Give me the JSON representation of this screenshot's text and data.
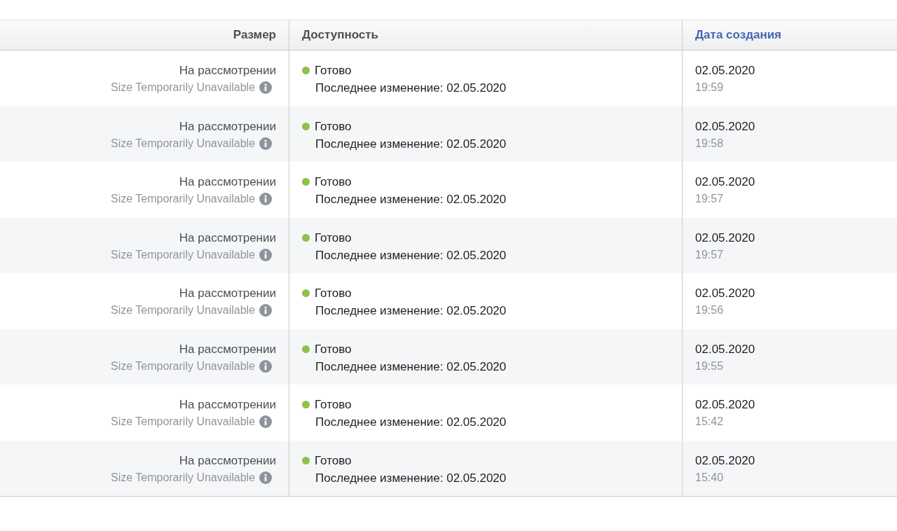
{
  "table": {
    "columns": [
      {
        "label": "Размер",
        "selected": false
      },
      {
        "label": "Доступность",
        "selected": false
      },
      {
        "label": "Дата создания",
        "selected": true
      }
    ],
    "rows": [
      {
        "size": "На рассмотрении",
        "size_note": "Size Temporarily Unavailable",
        "status": "Готово",
        "color": "#8bc34a",
        "modified": "Последнее изменение: 02.05.2020",
        "date": "02.05.2020",
        "time": "19:59"
      },
      {
        "size": "На рассмотрении",
        "size_note": "Size Temporarily Unavailable",
        "status": "Готово",
        "color": "#8bc34a",
        "modified": "Последнее изменение: 02.05.2020",
        "date": "02.05.2020",
        "time": "19:58"
      },
      {
        "size": "На рассмотрении",
        "size_note": "Size Temporarily Unavailable",
        "status": "Готово",
        "color": "#8bc34a",
        "modified": "Последнее изменение: 02.05.2020",
        "date": "02.05.2020",
        "time": "19:57"
      },
      {
        "size": "На рассмотрении",
        "size_note": "Size Temporarily Unavailable",
        "status": "Готово",
        "color": "#8bc34a",
        "modified": "Последнее изменение: 02.05.2020",
        "date": "02.05.2020",
        "time": "19:57"
      },
      {
        "size": "На рассмотрении",
        "size_note": "Size Temporarily Unavailable",
        "status": "Готово",
        "color": "#8bc34a",
        "modified": "Последнее изменение: 02.05.2020",
        "date": "02.05.2020",
        "time": "19:56"
      },
      {
        "size": "На рассмотрении",
        "size_note": "Size Temporarily Unavailable",
        "status": "Готово",
        "color": "#8bc34a",
        "modified": "Последнее изменение: 02.05.2020",
        "date": "02.05.2020",
        "time": "19:55"
      },
      {
        "size": "На рассмотрении",
        "size_note": "Size Temporarily Unavailable",
        "status": "Готово",
        "color": "#8bc34a",
        "modified": "Последнее изменение: 02.05.2020",
        "date": "02.05.2020",
        "time": "15:42"
      },
      {
        "size": "На рассмотрении",
        "size_note": "Size Temporarily Unavailable",
        "status": "Готово",
        "color": "#8bc34a",
        "modified": "Последнее изменение: 02.05.2020",
        "date": "02.05.2020",
        "time": "15:40"
      }
    ]
  }
}
